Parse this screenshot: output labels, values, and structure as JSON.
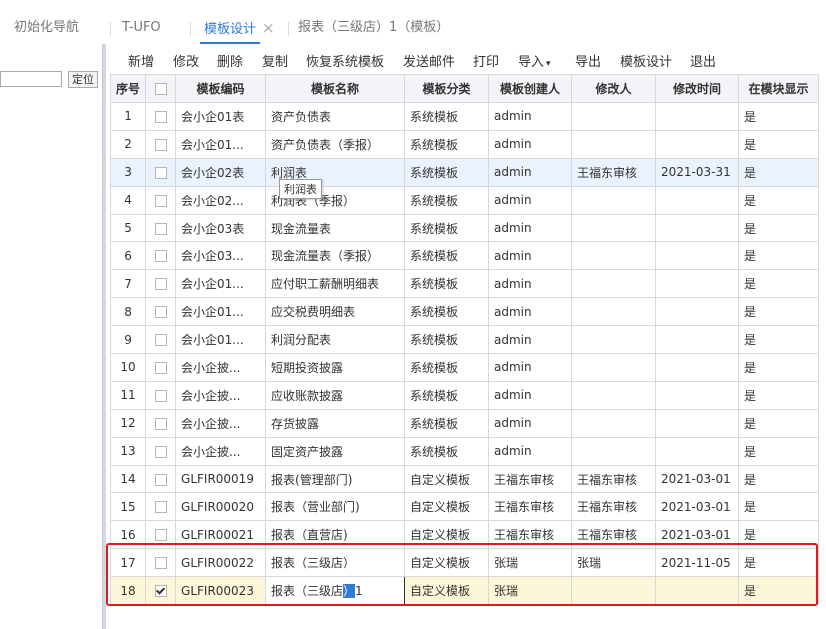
{
  "tabs": [
    {
      "label": "初始化导航"
    },
    {
      "label": "T-UFO"
    },
    {
      "label": "模板设计",
      "active": true
    },
    {
      "label": "报表（三级店）1（模板）"
    }
  ],
  "tab_close_icon": "×",
  "left_panel": {
    "locate_label": "定位",
    "search_value": ""
  },
  "toolbar": {
    "buttons": [
      "新增",
      "修改",
      "删除",
      "复制",
      "恢复系统模板",
      "发送邮件",
      "打印",
      "导入",
      "导出",
      "模板设计",
      "退出"
    ],
    "caret_icon": "▾"
  },
  "table": {
    "columns": [
      "序号",
      "",
      "模板编码",
      "模板名称",
      "模板分类",
      "模板创建人",
      "修改人",
      "修改时间",
      "在模块显示"
    ],
    "rows": [
      {
        "idx": "1",
        "checked": false,
        "code": "会小企01表",
        "name": "资产负债表",
        "category": "系统模板",
        "creator": "admin",
        "modifier": "",
        "time": "",
        "show": "是"
      },
      {
        "idx": "2",
        "checked": false,
        "code": "会小企01...",
        "name": "资产负债表（季报）",
        "category": "系统模板",
        "creator": "admin",
        "modifier": "",
        "time": "",
        "show": "是"
      },
      {
        "idx": "3",
        "checked": false,
        "code": "会小企02表",
        "name": "利润表",
        "category": "系统模板",
        "creator": "admin",
        "modifier": "王福东审核",
        "time": "2021-03-31",
        "show": "是"
      },
      {
        "idx": "4",
        "checked": false,
        "code": "会小企02...",
        "name": "利润表（季报）",
        "category": "系统模板",
        "creator": "admin",
        "modifier": "",
        "time": "",
        "show": "是"
      },
      {
        "idx": "5",
        "checked": false,
        "code": "会小企03表",
        "name": "现金流量表",
        "category": "系统模板",
        "creator": "admin",
        "modifier": "",
        "time": "",
        "show": "是"
      },
      {
        "idx": "6",
        "checked": false,
        "code": "会小企03...",
        "name": "现金流量表（季报）",
        "category": "系统模板",
        "creator": "admin",
        "modifier": "",
        "time": "",
        "show": "是"
      },
      {
        "idx": "7",
        "checked": false,
        "code": "会小企01...",
        "name": "应付职工薪酬明细表",
        "category": "系统模板",
        "creator": "admin",
        "modifier": "",
        "time": "",
        "show": "是"
      },
      {
        "idx": "8",
        "checked": false,
        "code": "会小企01...",
        "name": "应交税费明细表",
        "category": "系统模板",
        "creator": "admin",
        "modifier": "",
        "time": "",
        "show": "是"
      },
      {
        "idx": "9",
        "checked": false,
        "code": "会小企01...",
        "name": "利润分配表",
        "category": "系统模板",
        "creator": "admin",
        "modifier": "",
        "time": "",
        "show": "是"
      },
      {
        "idx": "10",
        "checked": false,
        "code": "会小企披...",
        "name": "短期投资披露",
        "category": "系统模板",
        "creator": "admin",
        "modifier": "",
        "time": "",
        "show": "是"
      },
      {
        "idx": "11",
        "checked": false,
        "code": "会小企披...",
        "name": "应收账款披露",
        "category": "系统模板",
        "creator": "admin",
        "modifier": "",
        "time": "",
        "show": "是"
      },
      {
        "idx": "12",
        "checked": false,
        "code": "会小企披...",
        "name": "存货披露",
        "category": "系统模板",
        "creator": "admin",
        "modifier": "",
        "time": "",
        "show": "是"
      },
      {
        "idx": "13",
        "checked": false,
        "code": "会小企披...",
        "name": "固定资产披露",
        "category": "系统模板",
        "creator": "admin",
        "modifier": "",
        "time": "",
        "show": "是"
      },
      {
        "idx": "14",
        "checked": false,
        "code": "GLFIR00019",
        "name": "报表(管理部门)",
        "category": "自定义模板",
        "creator": "王福东审核",
        "modifier": "王福东审核",
        "time": "2021-03-01",
        "show": "是"
      },
      {
        "idx": "15",
        "checked": false,
        "code": "GLFIR00020",
        "name": "报表（营业部门)",
        "category": "自定义模板",
        "creator": "王福东审核",
        "modifier": "王福东审核",
        "time": "2021-03-01",
        "show": "是"
      },
      {
        "idx": "16",
        "checked": false,
        "code": "GLFIR00021",
        "name": "报表（直营店)",
        "category": "自定义模板",
        "creator": "王福东审核",
        "modifier": "王福东审核",
        "time": "2021-03-01",
        "show": "是"
      },
      {
        "idx": "17",
        "checked": false,
        "code": "GLFIR00022",
        "name": "报表（三级店）",
        "category": "自定义模板",
        "creator": "张瑞",
        "modifier": "张瑞",
        "time": "2021-11-05",
        "show": "是"
      },
      {
        "idx": "18",
        "checked": true,
        "code": "GLFIR00023",
        "name_pre": "报表（三级店",
        "name_sel": "）",
        "name_post": "1",
        "category": "自定义模板",
        "creator": "张瑞",
        "modifier": "",
        "time": "",
        "show": "是"
      }
    ]
  },
  "tooltip": {
    "text": "利润表"
  },
  "colors": {
    "accent": "#2f7bd6",
    "highlight_row": "#eaf3fd",
    "selected_row": "#fdf6d8",
    "annotation_box": "#e0191e"
  }
}
